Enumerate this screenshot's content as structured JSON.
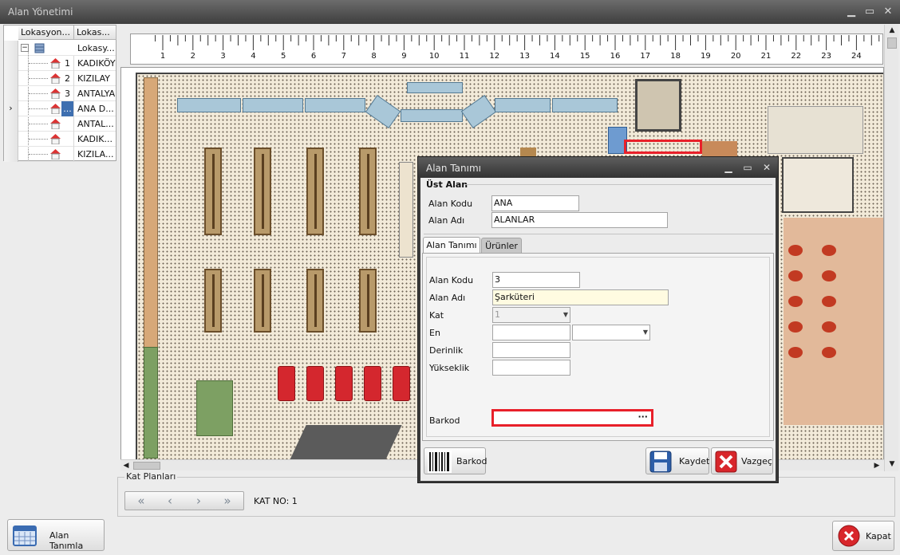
{
  "window": {
    "title": "Alan Yönetimi"
  },
  "grid": {
    "col1": "Lokasyon...",
    "col2": "Lokas...",
    "root_label": "Lokasy...",
    "rows": [
      {
        "num": "1",
        "name": "KADIKÖY"
      },
      {
        "num": "2",
        "name": "KIZILAY"
      },
      {
        "num": "3",
        "name": "ANTALYA"
      },
      {
        "num": "...",
        "name": "ANA D..."
      },
      {
        "num": "",
        "name": "ANTAL..."
      },
      {
        "num": "",
        "name": "KADIK..."
      },
      {
        "num": "",
        "name": "KIZILA..."
      }
    ],
    "selected_indicator": "›"
  },
  "ruler": {
    "numbers": [
      "1",
      "2",
      "3",
      "4",
      "5",
      "6",
      "7",
      "8",
      "9",
      "10",
      "11",
      "12",
      "13",
      "14",
      "15",
      "16",
      "17",
      "18",
      "19",
      "20",
      "21",
      "22",
      "23",
      "24"
    ]
  },
  "kat": {
    "legend": "Kat Planları",
    "first": "«",
    "prev": "‹",
    "next": "›",
    "last": "»",
    "kat_no": "KAT NO:  1"
  },
  "buttons": {
    "alan_tanimla": "Alan Tanımla",
    "kapat": "Kapat"
  },
  "dialog": {
    "title": "Alan Tanımı",
    "ust_alan": "Üst Alan",
    "ust_kodu_label": "Alan Kodu",
    "ust_kodu_value": "ANA",
    "ust_adi_label": "Alan Adı",
    "ust_adi_value": "ALANLAR",
    "tab1": "Alan Tanımı",
    "tab2": "Ürünler",
    "kodu_label": "Alan Kodu",
    "kodu_value": "3",
    "adi_label": "Alan Adı",
    "adi_value": "Şarküteri",
    "kat_label": "Kat",
    "kat_value": "1",
    "en_label": "En",
    "derinlik_label": "Derinlik",
    "yukseklik_label": "Yükseklik",
    "barkod_label": "Barkod",
    "barkod_ellipsis": "···",
    "btn_barkod": "Barkod",
    "btn_kaydet": "Kaydet",
    "btn_vazgec": "Vazgeç"
  }
}
